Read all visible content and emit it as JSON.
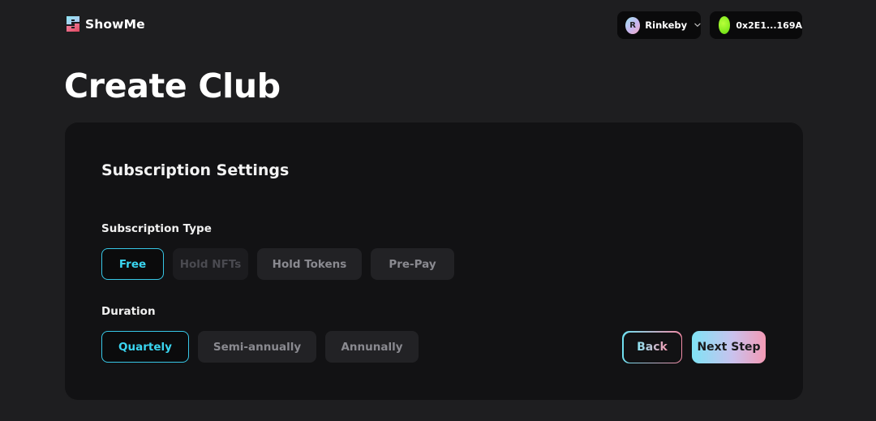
{
  "header": {
    "brand": "ShowMe",
    "network": {
      "initial": "R",
      "label": "Rinkeby"
    },
    "wallet": {
      "address": "0x2E1...169A"
    }
  },
  "page": {
    "title": "Create Club"
  },
  "form": {
    "section_title": "Subscription Settings",
    "subscription_type": {
      "label": "Subscription Type",
      "options": [
        {
          "label": "Free",
          "state": "selected"
        },
        {
          "label": "Hold NFTs",
          "state": "disabled"
        },
        {
          "label": "Hold Tokens",
          "state": "default"
        },
        {
          "label": "Pre-Pay",
          "state": "default"
        }
      ]
    },
    "duration": {
      "label": "Duration",
      "options": [
        {
          "label": "Quartely",
          "state": "selected"
        },
        {
          "label": "Semi-annually",
          "state": "default"
        },
        {
          "label": "Annunally",
          "state": "default"
        }
      ]
    },
    "back_label": "Back",
    "next_label": "Next Step"
  },
  "colors": {
    "background": "#1e1e20",
    "card": "#121214",
    "accent": "#3ad5f0",
    "gradient_start": "#7fe3f5",
    "gradient_end": "#f49ab5",
    "wallet_avatar": "#7ee81c"
  },
  "icons": {
    "logo": "showme-logo-icon",
    "network_dropdown": "chevron-down-icon"
  }
}
